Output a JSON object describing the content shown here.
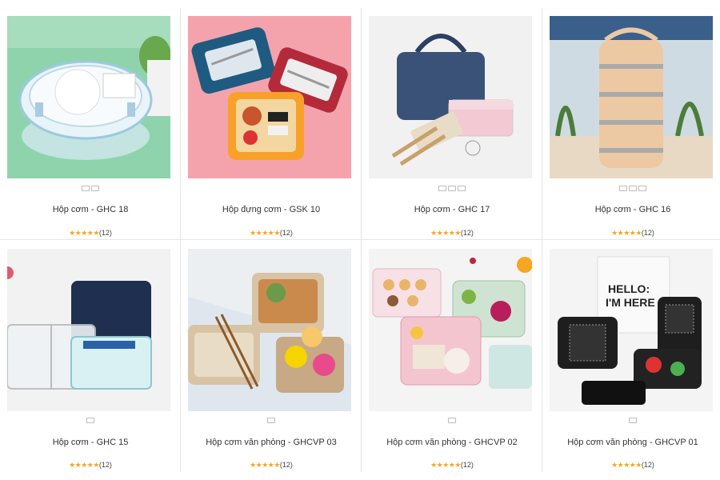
{
  "products": [
    {
      "name": "Hộp cơm - GHC 18",
      "rating_stars": "★★★★★",
      "review_count": "(12)",
      "image_desc": "round glass container",
      "dots": 2
    },
    {
      "name": "Hộp đựng cơm - GSK 10",
      "rating_stars": "★★★★★",
      "review_count": "(12)",
      "image_desc": "blue and red lunch boxes",
      "dots": 0
    },
    {
      "name": "Hộp cơm - GHC 17",
      "rating_stars": "★★★★★",
      "review_count": "(12)",
      "image_desc": "insulated bag with container",
      "dots": 3
    },
    {
      "name": "Hộp cơm - GHC 16",
      "rating_stars": "★★★★★",
      "review_count": "(12)",
      "image_desc": "stacked tiffin",
      "dots": 3
    },
    {
      "name": "Hộp cơm - GHC 15",
      "rating_stars": "★★★★★",
      "review_count": "(12)",
      "image_desc": "glass box with bag",
      "dots": 1
    },
    {
      "name": "Hộp cơm văn phòng - GHCVP 03",
      "rating_stars": "★★★★★",
      "review_count": "(12)",
      "image_desc": "wheat straw bento",
      "dots": 1
    },
    {
      "name": "Hộp cơm văn phòng - GHCVP 02",
      "rating_stars": "★★★★★",
      "review_count": "(12)",
      "image_desc": "pink and green bento",
      "dots": 1
    },
    {
      "name": "Hộp cơm văn phòng - GHCVP 01",
      "rating_stars": "★★★★★",
      "review_count": "(12)",
      "image_desc": "black grid bento",
      "dots": 1
    }
  ],
  "poster_text": "HELLO:\nI'M HERE",
  "colors": {
    "star": "#f5a623",
    "divider": "#e6e6e6"
  }
}
